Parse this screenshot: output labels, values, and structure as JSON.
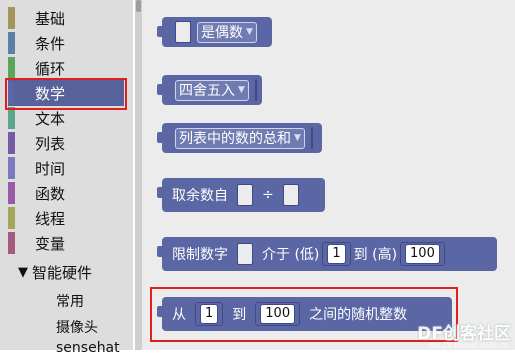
{
  "categories": [
    {
      "label": "基础",
      "color": "#a5955b"
    },
    {
      "label": "条件",
      "color": "#5b80a5"
    },
    {
      "label": "循环",
      "color": "#5ba55b"
    },
    {
      "label": "数学",
      "color": "#5b67a5"
    },
    {
      "label": "文本",
      "color": "#5ba58c"
    },
    {
      "label": "列表",
      "color": "#745ba5"
    },
    {
      "label": "时间",
      "color": "#7a7abf"
    },
    {
      "label": "函数",
      "color": "#995ba5"
    },
    {
      "label": "线程",
      "color": "#a5a55b"
    },
    {
      "label": "变量",
      "color": "#a55b80"
    }
  ],
  "hardware": {
    "label": "智能硬件",
    "arrow": "▼",
    "items": [
      "常用",
      "摄像头",
      "sensehat"
    ]
  },
  "blocks": {
    "is_even": {
      "label": "是偶数",
      "arrow": "▼"
    },
    "round": {
      "label": "四舍五入",
      "arrow": "▼"
    },
    "list_sum": {
      "label": "列表中的数的总和",
      "arrow": "▼"
    },
    "modulo": {
      "label": "取余数自",
      "op": "÷"
    },
    "constrain": {
      "label": "限制数字",
      "between": "介于 (低)",
      "low": "1",
      "to": "到 (高)",
      "high": "100"
    },
    "random_int": {
      "from": "从",
      "low": "1",
      "to": "到",
      "high": "100",
      "suffix": "之间的随机整数"
    }
  },
  "watermark": {
    "main": "DF创客社区",
    "sub": "mc.DFRobot.com.cn"
  }
}
